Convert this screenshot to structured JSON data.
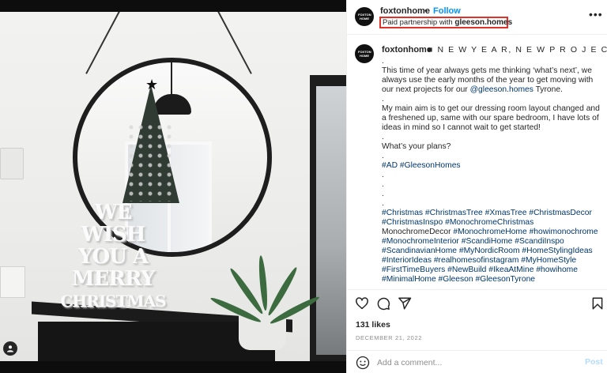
{
  "header": {
    "avatar_text": "FOXTON HOME",
    "username": "foxtonhome",
    "separator": "•",
    "follow_label": "Follow",
    "partnership_prefix": "Paid partnership with ",
    "partner_name": "gleeson.homes",
    "more_icon": "more-horizontal-icon"
  },
  "photo": {
    "sign_text": [
      "WE",
      "WISH",
      "YOU A",
      "MERRY",
      "CHRISTMAS"
    ]
  },
  "caption": {
    "username": "foxtonhome",
    "title": "■ N E W Y E A R, N E W P R O J E C T S ■",
    "lines_1": [
      "."
    ],
    "para_1_pre": "This time of year always gets me thinking ‘what’s next’, we always use the early months of the year to get moving with our next projects for our ",
    "para_1_mention": "@gleeson.homes",
    "para_1_post": " Tyrone.",
    "dot_2": ".",
    "para_2": "My main aim is to get our dressing room layout changed and a freshened up, same with our spare bedroom, I have lots of ideas in mind so I cannot wait to get started!",
    "dot_3": ".",
    "para_3": "What’s your plans?",
    "dot_4": ".",
    "tags_1": "#AD #GleesonHomes",
    "dots_after": [
      ".",
      ".",
      ".",
      "."
    ],
    "hashtags_a": "#Christmas #ChristmasTree #XmasTree #ChristmasDecor #ChristmasInspo #MonochromeChristmas",
    "hashtags_plain": " MonochromeDecor ",
    "hashtags_b": "#MonochromeHome #howimonochrome #MonochromeInterior #ScandiHome #ScandiInspo #ScandinavianHome #MyNordicRoom #HomeStylingIdeas #InteriorIdeas #realhomesofinstagram #MyHomeStyle #FirstTimeBuyers #NewBuild #IkeaAtMine #howihome #MinimalHome #Gleeson #GleesonTyrone"
  },
  "actions": {
    "like_icon": "heart-icon",
    "comment_icon": "comment-icon",
    "share_icon": "send-icon",
    "save_icon": "bookmark-icon",
    "likes": "131 likes",
    "date": "DECEMBER 21, 2022"
  },
  "comment": {
    "emoji_icon": "emoji-icon",
    "placeholder": "Add a comment...",
    "post_label": "Post"
  },
  "colors": {
    "link": "#00376b",
    "follow": "#0095f6",
    "highlight_border": "#e0312b",
    "post_disabled": "#b3dbff"
  }
}
